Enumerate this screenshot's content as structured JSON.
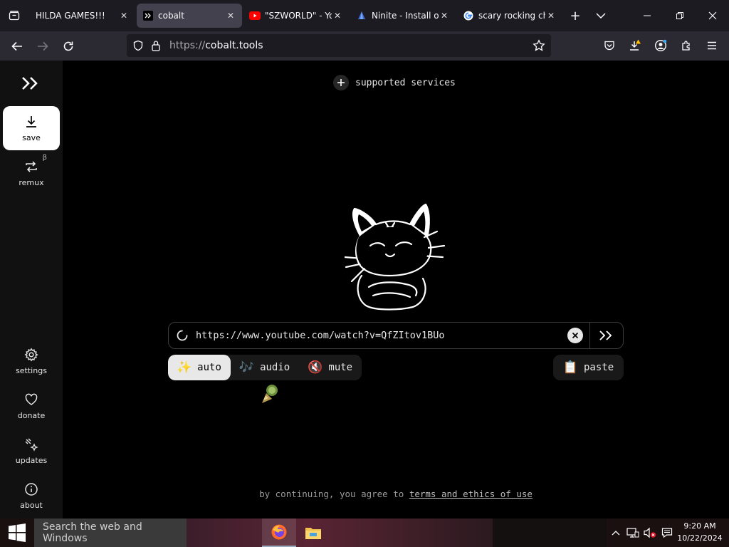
{
  "browser": {
    "tabs": [
      {
        "title": "HILDA GAMES!!!",
        "icon": "hilda-favicon",
        "active": false
      },
      {
        "title": "cobalt",
        "icon": "cobalt-favicon",
        "active": true
      },
      {
        "title": "\"SZWORLD\" - Yo",
        "icon": "youtube-favicon",
        "active": false
      },
      {
        "title": "Ninite - Install or",
        "icon": "ninite-favicon",
        "active": false
      },
      {
        "title": "scary rocking ch",
        "icon": "google-favicon",
        "active": false
      }
    ],
    "url": {
      "protocol": "https://",
      "host": "cobalt.tools"
    }
  },
  "sidebar": {
    "logo": ">>",
    "items": [
      {
        "label": "save",
        "icon": "download-icon",
        "active": true
      },
      {
        "label": "remux",
        "icon": "remux-icon",
        "badge": "β"
      },
      {
        "label": "settings",
        "icon": "gear-icon"
      },
      {
        "label": "donate",
        "icon": "heart-icon"
      },
      {
        "label": "updates",
        "icon": "sparkle-icon"
      },
      {
        "label": "about",
        "icon": "info-icon"
      }
    ]
  },
  "main": {
    "supported_services": "supported services",
    "link_input": {
      "value": "https://www.youtube.com/watch?v=QfZItov1BUo",
      "state": "loading"
    },
    "download_modes": [
      {
        "label": "auto",
        "emoji": "✨",
        "selected": true
      },
      {
        "label": "audio",
        "emoji": "🎶",
        "selected": false
      },
      {
        "label": "mute",
        "emoji": "🔇",
        "selected": false
      }
    ],
    "paste": {
      "label": "paste",
      "emoji": "📋"
    },
    "terms": {
      "prefix": "by continuing, you agree to",
      "link": "terms and ethics of use"
    }
  },
  "taskbar": {
    "search_placeholder": "Search the web and Windows",
    "apps": [
      "firefox-icon",
      "file-explorer-icon"
    ],
    "time": "9:20 AM",
    "date": "10/22/2024"
  },
  "colors": {
    "accent_white": "#ffffff",
    "background": "#000000",
    "sidebar": "#111111",
    "tab_active": "#42414d"
  }
}
